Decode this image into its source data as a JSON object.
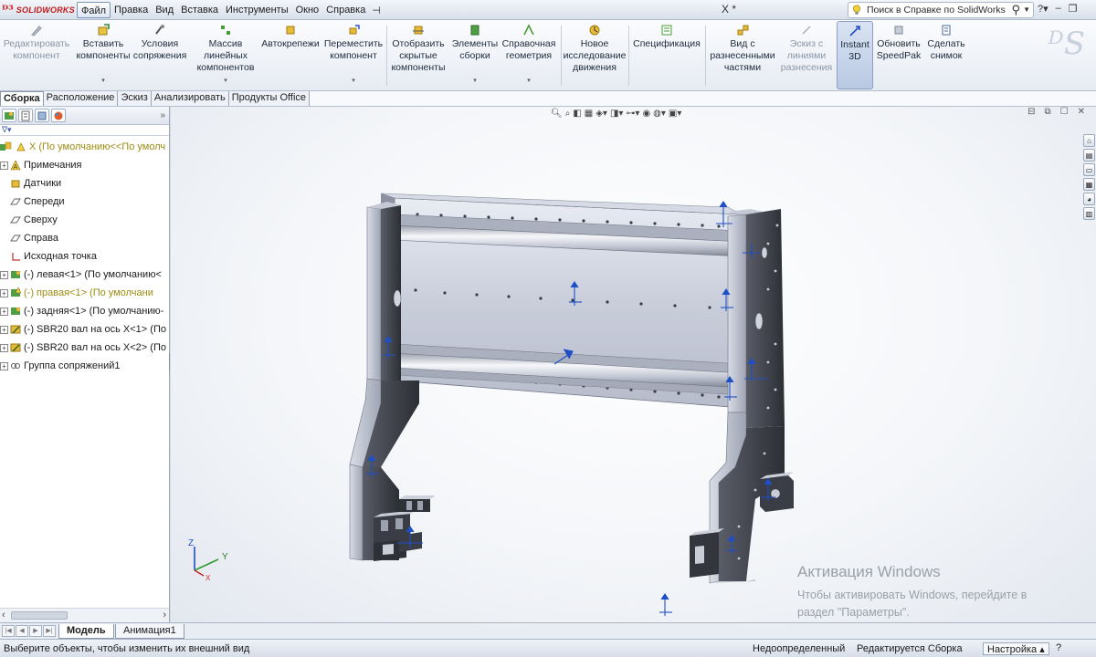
{
  "app": {
    "logo_text": "SOLIDWORKS",
    "doc_title": "X *",
    "menu": [
      "Файл",
      "Правка",
      "Вид",
      "Вставка",
      "Инструменты",
      "Окно",
      "Справка"
    ],
    "help_search_placeholder": "Поиск в Справке по SolidWorks"
  },
  "ribbon": {
    "buttons": [
      {
        "label": "Редактировать\nкомпонент",
        "icon": "edit-component-icon",
        "disabled": true
      },
      {
        "label": "Вставить\nкомпоненты",
        "icon": "insert-components-icon"
      },
      {
        "label": "Условия\nсопряжения",
        "icon": "mate-icon"
      },
      {
        "label": "Массив\nлинейных\nкомпонентов",
        "icon": "linear-pattern-icon"
      },
      {
        "label": "Автокрепежи",
        "icon": "smart-fasteners-icon"
      },
      {
        "label": "Переместить\nкомпонент",
        "icon": "move-component-icon"
      },
      {
        "label": "Отобразить\nскрытые\nкомпоненты",
        "icon": "show-hidden-icon"
      },
      {
        "label": "Элементы\nсборки",
        "icon": "assembly-features-icon"
      },
      {
        "label": "Справочная\nгеометрия",
        "icon": "reference-geometry-icon"
      },
      {
        "label": "Новое\nисследование\nдвижения",
        "icon": "motion-study-icon"
      },
      {
        "label": "Спецификация",
        "icon": "bom-icon"
      },
      {
        "label": "Вид с\nразнесенными\nчастями",
        "icon": "exploded-view-icon"
      },
      {
        "label": "Эскиз с\nлиниями\nразнесения",
        "icon": "explode-line-sketch-icon",
        "disabled": true
      },
      {
        "label": "Instant\n3D",
        "icon": "instant3d-icon",
        "pressed": true
      },
      {
        "label": "Обновить\nSpeedPak",
        "icon": "speedpak-icon"
      },
      {
        "label": "Сделать\nснимок",
        "icon": "snapshot-icon"
      }
    ]
  },
  "tabs": [
    "Сборка",
    "Расположение",
    "Эскиз",
    "Анализировать",
    "Продукты Office"
  ],
  "tree": {
    "root": "X  (По умолчанию<<По умолч",
    "items": [
      {
        "label": "Примечания",
        "icon": "annotations-icon",
        "expand": true
      },
      {
        "label": "Датчики",
        "icon": "sensors-icon",
        "expand": false
      },
      {
        "label": "Спереди",
        "icon": "plane-icon",
        "expand": false
      },
      {
        "label": "Сверху",
        "icon": "plane-icon",
        "expand": false
      },
      {
        "label": "Справа",
        "icon": "plane-icon",
        "expand": false
      },
      {
        "label": "Исходная точка",
        "icon": "origin-icon",
        "expand": false
      },
      {
        "label": "(-) левая<1> (По умолчанию<",
        "icon": "part-icon",
        "expand": true
      },
      {
        "label": "(-) правая<1> (По умолчани",
        "icon": "part-warning-icon",
        "expand": true,
        "warn": true
      },
      {
        "label": "(-) задняя<1> (По умолчанию-",
        "icon": "part-icon",
        "expand": true
      },
      {
        "label": "(-) SBR20 вал на ось X<1> (По",
        "icon": "part-icon",
        "expand": true
      },
      {
        "label": "(-) SBR20 вал на ось X<2> (По",
        "icon": "part-icon",
        "expand": true
      },
      {
        "label": "Группа сопряжений1",
        "icon": "mates-group-icon",
        "expand": true
      }
    ]
  },
  "triad": {
    "z": "Z",
    "y": "Y",
    "x": "X"
  },
  "activation": {
    "title": "Активация Windows",
    "line1": "Чтобы активировать Windows, перейдите в",
    "line2": "раздел \"Параметры\"."
  },
  "bottom_tabs": [
    "Модель",
    "Анимация1"
  ],
  "status": {
    "hint": "Выберите объекты, чтобы изменить их внешний вид",
    "defined": "Недоопределенный",
    "editing": "Редактируется Сборка",
    "custom": "Настройка",
    "help": "?"
  },
  "colors": {
    "accent": "#1f4fc4",
    "metal_dark": "#3b3d45",
    "metal_light": "#c8ccd8"
  }
}
